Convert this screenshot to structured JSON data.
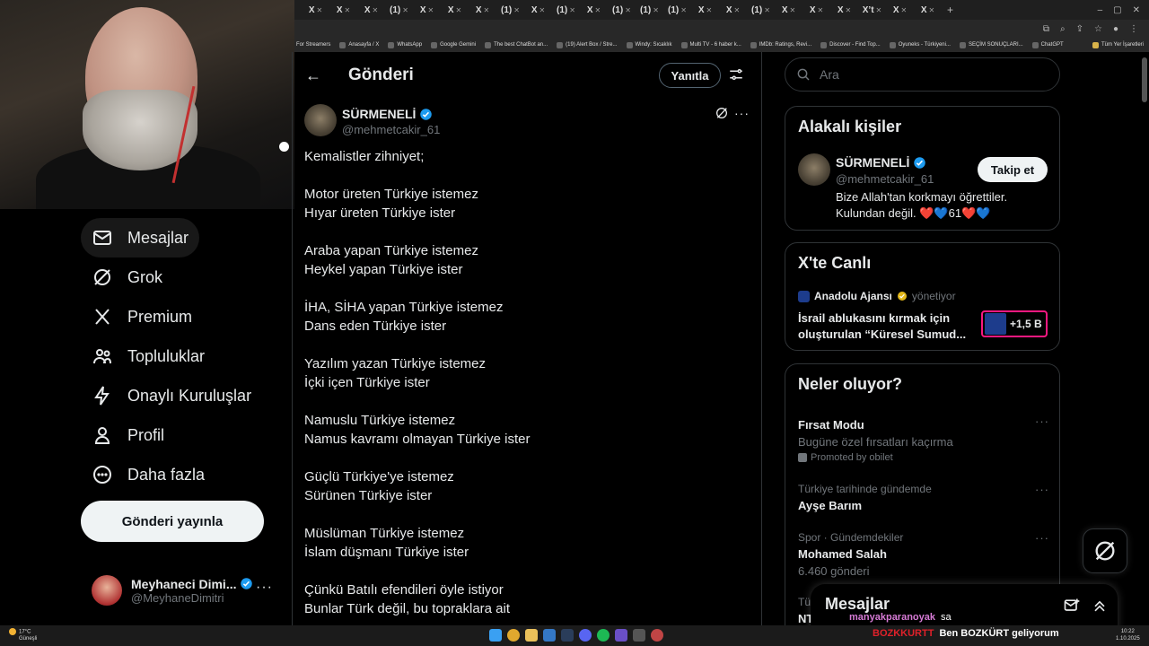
{
  "browser": {
    "tabs": [
      {
        "label": "X"
      },
      {
        "label": "X"
      },
      {
        "label": "X"
      },
      {
        "label": "(1)"
      },
      {
        "label": "X"
      },
      {
        "label": "X"
      },
      {
        "label": "X"
      },
      {
        "label": "(1)"
      },
      {
        "label": "X"
      },
      {
        "label": "(1)"
      },
      {
        "label": "X"
      },
      {
        "label": "(1)"
      },
      {
        "label": "(1)"
      },
      {
        "label": "(1)"
      },
      {
        "label": "X"
      },
      {
        "label": "X"
      },
      {
        "label": "(1)"
      },
      {
        "label": "X"
      },
      {
        "label": "X"
      },
      {
        "label": "X"
      },
      {
        "label": "X’t"
      },
      {
        "label": "X"
      },
      {
        "label": "X"
      }
    ],
    "bookmarks": [
      "For Streamers",
      "Anasayfa / X",
      "WhatsApp",
      "Google Gemini",
      "The best ChatBot an...",
      "(19) Alert Box / Stre...",
      "Windy: Sıcaklık",
      "Multi TV - 6 haber k...",
      "IMDb: Ratings, Revi...",
      "Discover - Find Top...",
      "Oyuneks - Türkiyeni...",
      "SEÇİM SONUÇLARI...",
      "ChatGPT"
    ],
    "bookmarks_other": "Tüm Yer İşaretleri"
  },
  "nav": {
    "items": [
      {
        "label": "Mesajlar",
        "icon": "envelope-icon"
      },
      {
        "label": "Grok",
        "icon": "grok-icon"
      },
      {
        "label": "Premium",
        "icon": "x-logo-icon"
      },
      {
        "label": "Topluluklar",
        "icon": "communities-icon"
      },
      {
        "label": "Onaylı Kuruluşlar",
        "icon": "lightning-icon"
      },
      {
        "label": "Profil",
        "icon": "person-icon"
      },
      {
        "label": "Daha fazla",
        "icon": "more-circle-icon"
      }
    ],
    "post_button": "Gönderi yayınla",
    "account": {
      "name": "Meyhaneci Dimi...",
      "handle": "@MeyhaneDimitri"
    }
  },
  "post": {
    "header_title": "Gönderi",
    "reply_button": "Yanıtla",
    "author_name": "SÜRMENELİ",
    "author_handle": "@mehmetcakir_61",
    "body": "Kemalistler zihniyet;\n\nMotor üreten Türkiye istemez\nHıyar üreten Türkiye ister\n\nAraba yapan Türkiye istemez\nHeykel yapan Türkiye ister\n\nİHA, SİHA yapan Türkiye istemez\nDans eden Türkiye ister\n\nYazılım yazan Türkiye istemez\nİçki içen Türkiye ister\n\nNamuslu Türkiye istemez\nNamus kavramı olmayan Türkiye ister\n\nGüçlü Türkiye'ye istemez\nSürünen Türkiye ister\n\nMüslüman Türkiye istemez\nİslam düşmanı Türkiye ister\n\nÇünkü Batılı efendileri öyle istiyor\nBunlar Türk değil, bu topraklara ait"
  },
  "search": {
    "placeholder": "Ara"
  },
  "related": {
    "title": "Alakalı kişiler",
    "name": "SÜRMENELİ",
    "handle": "@mehmetcakir_61",
    "follow_button": "Takip et",
    "bio": "Bize Allah'tan korkmayı öğrettiler. Kulundan değil. ❤️💙61❤️💙"
  },
  "live": {
    "title": "X'te Canlı",
    "source": "Anadolu Ajansı",
    "role": "yönetiyor",
    "headline": "İsrail ablukasını kırmak için oluşturulan “Küresel Sumud...",
    "listeners": "+1,5 B"
  },
  "trends": {
    "title": "Neler oluyor?",
    "items": [
      {
        "context": "",
        "title": "Fırsat Modu",
        "sub": "Bugüne özel fırsatları kaçırma",
        "promo": "Promoted by obilet"
      },
      {
        "context": "Türkiye tarihinde gündemde",
        "title": "Ayşe Barım",
        "sub": "",
        "promo": ""
      },
      {
        "context": "Spor · Gündemdekiler",
        "title": "Mohamed Salah",
        "sub": "6.460 gönderi",
        "promo": ""
      },
      {
        "context": "Tür",
        "title": "NT",
        "sub": "",
        "promo": ""
      }
    ]
  },
  "messages_drawer": {
    "title": "Mesajlar"
  },
  "chat_overlay": {
    "user": "manyakparanoyak",
    "message": "sa"
  },
  "ticker": {
    "tag": "BOZKKURTT",
    "text": "Ben BOZKÜRT geliyorum"
  },
  "system": {
    "temp": "17°C",
    "weather": "Güneşli",
    "time": "10:22",
    "date": "1.10.2025"
  },
  "colors": {
    "accent": "#1d9bf0",
    "live_border": "#f91880",
    "ticker_red": "#e0212a"
  }
}
